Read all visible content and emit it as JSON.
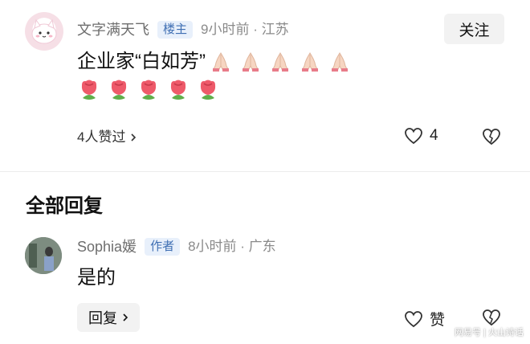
{
  "comment": {
    "username": "文字满天飞",
    "badge": "楼主",
    "meta": "9小时前 · 江苏",
    "follow_label": "关注",
    "text": "企业家“白如芳”",
    "likers_text": "4人赞过",
    "like_count": "4",
    "emoji": {
      "pray": "praying-hands-emoji",
      "rose": "rose-emoji"
    }
  },
  "replies_section": {
    "title": "全部回复"
  },
  "reply": {
    "username": "Sophia媛",
    "badge": "作者",
    "meta": "8小时前 · 广东",
    "text": "是的",
    "reply_button_label": "回复",
    "like_label": "赞"
  },
  "watermark": "网易号 | 火山诗话",
  "colors": {
    "badge_bg": "#e8f0fb",
    "badge_text": "#3f6fb3",
    "meta_text": "#8a8a8a",
    "button_bg": "#f2f2f2"
  }
}
